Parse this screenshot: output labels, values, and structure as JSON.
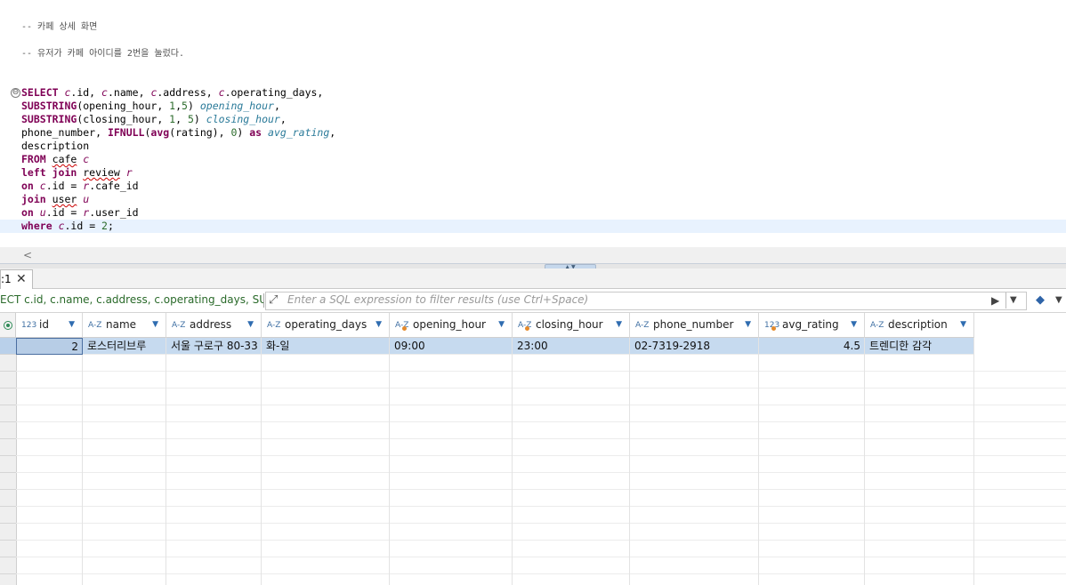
{
  "editor": {
    "comment1": "-- 카페 상세 화면",
    "comment2": "-- 유저가 카페 아이디를 2번을 눌렀다.",
    "sql": {
      "l1_kw": "SELECT ",
      "l1_a1": "c",
      "l1_t1": ".id, ",
      "l1_a2": "c",
      "l1_t2": ".name, ",
      "l1_a3": "c",
      "l1_t3": ".address, ",
      "l1_a4": "c",
      "l1_t4": ".operating_days,",
      "l2_kw": "SUBSTRING",
      "l2_t1": "(opening_hour, ",
      "l2_n1": "1",
      "l2_t2": ",",
      "l2_n2": "5",
      "l2_t3": ") ",
      "l2_al": "opening_hour",
      "l2_t4": ",",
      "l3_kw": "SUBSTRING",
      "l3_t1": "(closing_hour, ",
      "l3_n1": "1",
      "l3_t2": ", ",
      "l3_n2": "5",
      "l3_t3": ") ",
      "l3_al": "closing_hour",
      "l3_t4": ",",
      "l4_t1": "phone_number, ",
      "l4_kw1": "IFNULL",
      "l4_t2": "(",
      "l4_kw2": "avg",
      "l4_t3": "(rating), ",
      "l4_n1": "0",
      "l4_t4": ") ",
      "l4_kw3": "as",
      "l4_t5": " ",
      "l4_al": "avg_rating",
      "l4_t6": ",",
      "l5_t1": "description",
      "l6_kw": "FROM",
      "l6_t1": " ",
      "l6_tb": "cafe",
      "l6_t2": " ",
      "l6_al": "c",
      "l7_kw": "left join",
      "l7_t1": " ",
      "l7_tb": "review",
      "l7_t2": " ",
      "l7_al": "r",
      "l8_kw": "on",
      "l8_t1": " ",
      "l8_a1": "c",
      "l8_t2": ".id = ",
      "l8_a2": "r",
      "l8_t3": ".cafe_id",
      "l9_kw": "join",
      "l9_t1": " ",
      "l9_tb": "user",
      "l9_t2": " ",
      "l9_al": "u",
      "l10_kw": "on",
      "l10_t1": " ",
      "l10_a1": "u",
      "l10_t2": ".id = ",
      "l10_a2": "r",
      "l10_t3": ".user_id",
      "l11_kw": "where",
      "l11_t1": " ",
      "l11_a1": "c",
      "l11_t2": ".id = ",
      "l11_n1": "2",
      "l11_t3": ";"
    },
    "collapse_glyph": "⊖",
    "scroll_left_glyph": "<"
  },
  "result_tab": {
    "label": ":1",
    "close_glyph": "✕"
  },
  "filter": {
    "query_text": "ECT c.id, c.name, c.address, c.operating_days, SUBSTRI",
    "placeholder": "Enter a SQL expression to filter results (use Ctrl+Space)",
    "expand_icon": "⤢",
    "run_icon": "▶",
    "dropdown_icon": "▼",
    "erase_icon": "◆"
  },
  "columns": [
    {
      "name": "id",
      "type_icon": "123",
      "time": false
    },
    {
      "name": "name",
      "type_icon": "A-Z",
      "time": false
    },
    {
      "name": "address",
      "type_icon": "A-Z",
      "time": false
    },
    {
      "name": "operating_days",
      "type_icon": "A-Z",
      "time": false
    },
    {
      "name": "opening_hour",
      "type_icon": "A-Z",
      "time": true
    },
    {
      "name": "closing_hour",
      "type_icon": "A-Z",
      "time": true
    },
    {
      "name": "phone_number",
      "type_icon": "A-Z",
      "time": false
    },
    {
      "name": "avg_rating",
      "type_icon": "123",
      "time": true
    },
    {
      "name": "description",
      "type_icon": "A-Z",
      "time": false
    }
  ],
  "rows": [
    [
      "2",
      "로스터리브루",
      "서울 구로구 80-33",
      "화-일",
      "09:00",
      "23:00",
      "02-7319-2918",
      "4.5",
      "트렌디한 감각"
    ]
  ],
  "header_dropdown_glyph": "▼",
  "colors": {
    "keyword": "#7f0055",
    "selected_row": "#c6daef",
    "column_alias": "#2a7a99"
  }
}
